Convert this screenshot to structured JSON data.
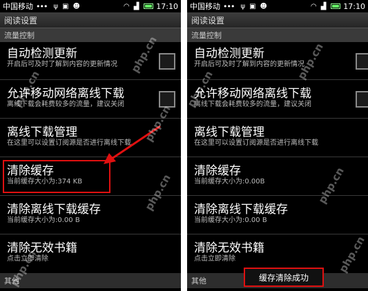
{
  "status_bar": {
    "carrier": "中国移动",
    "dots": "•••",
    "time": "17:10"
  },
  "app_title": "阅读设置",
  "left": {
    "section_top": "流量控制",
    "items": [
      {
        "title": "自动检测更新",
        "sub": "开启后可及时了解到内容的更新情况"
      },
      {
        "title": "允许移动网络离线下载",
        "sub": "离线下载会耗费较多的流量，建议关闭"
      },
      {
        "title": "离线下载管理",
        "sub": "在这里可以设置订阅源是否进行离线下载"
      },
      {
        "title": "清除缓存",
        "sub": "当前缓存大小为:374 KB"
      },
      {
        "title": "清除离线下载缓存",
        "sub": "当前缓存大小为:0.00 B"
      },
      {
        "title": "清除无效书籍",
        "sub": "点击立即清除"
      }
    ],
    "section_bottom": "其他"
  },
  "right": {
    "section_top": "流量控制",
    "items": [
      {
        "title": "自动检测更新",
        "sub": "开启后可及时了解到内容的更新情况"
      },
      {
        "title": "允许移动网络离线下载",
        "sub": "离线下载会耗费较多的流量，建议关闭"
      },
      {
        "title": "离线下载管理",
        "sub": "在这里可以设置订阅源是否进行离线下载"
      },
      {
        "title": "清除缓存",
        "sub": "当前缓存大小为:0.00B"
      },
      {
        "title": "清除离线下载缓存",
        "sub": "当前缓存大小为:0.00 B"
      },
      {
        "title": "清除无效书籍",
        "sub": "点击立即清除"
      }
    ],
    "section_bottom": "其他",
    "toast": "缓存清除成功"
  },
  "watermark": "php.cn",
  "colors": {
    "annotation_red": "#e01010",
    "background": "#000000"
  }
}
